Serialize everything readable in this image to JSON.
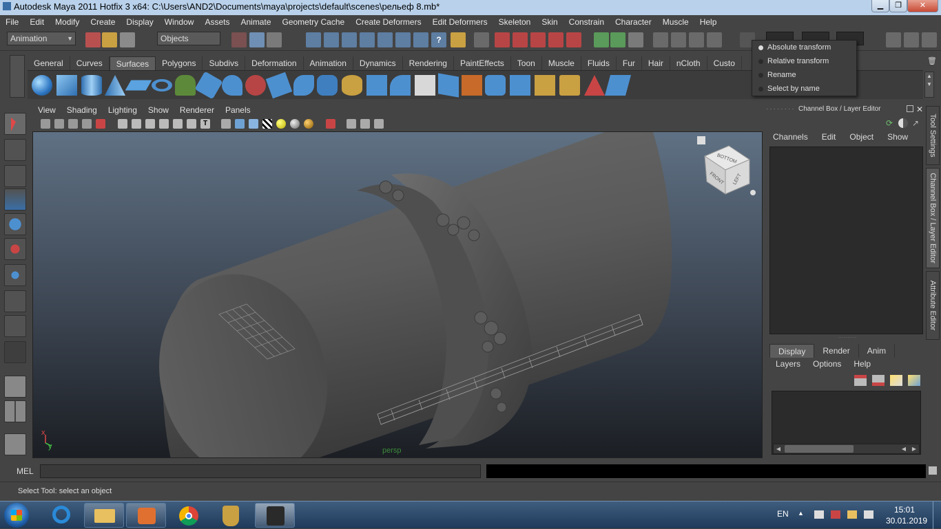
{
  "window": {
    "title": "Autodesk Maya 2011 Hotfix 3 x64: C:\\Users\\AND2\\Documents\\maya\\projects\\default\\scenes\\рельеф 8.mb*"
  },
  "menus": [
    "File",
    "Edit",
    "Modify",
    "Create",
    "Display",
    "Window",
    "Assets",
    "Animate",
    "Geometry Cache",
    "Create Deformers",
    "Edit Deformers",
    "Skeleton",
    "Skin",
    "Constrain",
    "Character",
    "Muscle",
    "Help"
  ],
  "status_line": {
    "mode": "Animation",
    "selection_field": "Objects"
  },
  "popup_menu": {
    "items": [
      "Absolute transform",
      "Relative transform",
      "Rename",
      "Select by name"
    ],
    "selected": "Absolute transform"
  },
  "shelf_tabs": [
    "General",
    "Curves",
    "Surfaces",
    "Polygons",
    "Subdivs",
    "Deformation",
    "Animation",
    "Dynamics",
    "Rendering",
    "PaintEffects",
    "Toon",
    "Muscle",
    "Fluids",
    "Fur",
    "Hair",
    "nCloth",
    "Custo"
  ],
  "active_shelf": "Surfaces",
  "viewport": {
    "menu": [
      "View",
      "Shading",
      "Lighting",
      "Show",
      "Renderer",
      "Panels"
    ],
    "camera_label": "persp",
    "viewcube": {
      "top": "BOTTOM",
      "front": "FRONT",
      "side": "LEFT"
    },
    "axis": {
      "x": "x",
      "y": "y"
    }
  },
  "channel_box": {
    "title": "Channel Box / Layer Editor",
    "menu": [
      "Channels",
      "Edit",
      "Object",
      "Show"
    ]
  },
  "layer_editor": {
    "tabs": [
      "Display",
      "Render",
      "Anim"
    ],
    "active": "Display",
    "menu": [
      "Layers",
      "Options",
      "Help"
    ]
  },
  "side_tabs": [
    "Tool Settings",
    "Channel Box / Layer Editor",
    "Attribute Editor"
  ],
  "command_line": {
    "label": "MEL"
  },
  "help_line": {
    "text": "Select Tool: select an object"
  },
  "taskbar": {
    "language": "EN",
    "time": "15:01",
    "date": "30.01.2019"
  },
  "colors": {
    "maya_bg": "#444444",
    "titlebar": "#b9d1ea",
    "taskbar": "#1f3a5a"
  }
}
